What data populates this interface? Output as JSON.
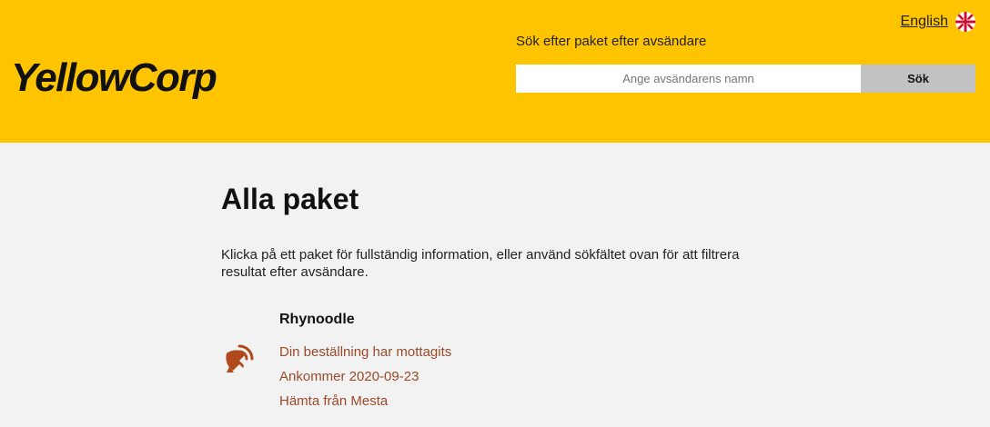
{
  "header": {
    "logo": "YellowCorp",
    "language_link": "English",
    "flag_icon": "uk-flag-icon",
    "search": {
      "label": "Sök efter paket efter avsändare",
      "placeholder": "Ange avsändarens namn",
      "value": "",
      "button_label": "Sök"
    }
  },
  "main": {
    "title": "Alla paket",
    "intro": "Klicka på ett paket för fullständig information, eller använd sökfältet ovan för att filtrera resultat efter avsändare.",
    "packages": [
      {
        "sender": "Rhynoodle",
        "icon": "satellite-dish-icon",
        "status": "Din beställning har mottagits",
        "arrival": "Ankommer 2020-09-23",
        "pickup": "Hämta från Mesta"
      }
    ]
  },
  "colors": {
    "header_bg": "#ffc400",
    "page_bg": "#f2f2f2",
    "accent_text": "#9a4a2a",
    "search_button_bg": "#c2c2c2"
  }
}
